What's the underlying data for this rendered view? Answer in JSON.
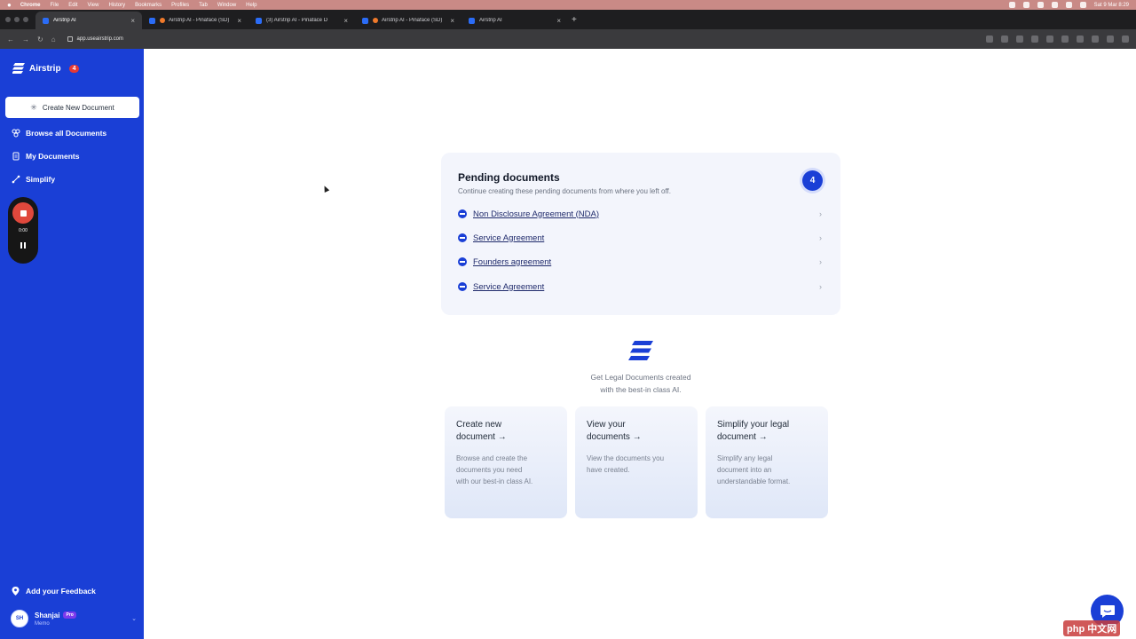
{
  "menubar": {
    "app": "Chrome",
    "items": [
      "File",
      "Edit",
      "View",
      "History",
      "Bookmarks",
      "Profiles",
      "Tab",
      "Window",
      "Help"
    ],
    "clock": "Sat 9 Mar 8:29"
  },
  "tabs": [
    {
      "title": "Airstrip AI",
      "active": true
    },
    {
      "title": "Airstrip AI - Pinaface (SD)",
      "active": false
    },
    {
      "title": "(3) Airstrip AI - Pinaface D",
      "active": false
    },
    {
      "title": "Airstrip AI - Pinaface (SD)",
      "active": false
    },
    {
      "title": "Airstrip AI",
      "active": false
    }
  ],
  "address": {
    "url": "app.useairstrip.com"
  },
  "sidebar": {
    "brand": "Airstrip",
    "brand_badge": "4",
    "create_label": "Create New Document",
    "items": [
      {
        "label": "Browse all Documents"
      },
      {
        "label": "My Documents"
      },
      {
        "label": "Simplify"
      }
    ],
    "recorder_time": "0:00",
    "feedback_label": "Add your Feedback",
    "user": {
      "initials": "SH",
      "name": "Shanjai",
      "badge": "Pro",
      "role": "Memo"
    }
  },
  "pending": {
    "title": "Pending documents",
    "subtitle": "Continue creating these pending documents from where you left off.",
    "count": "4",
    "docs": [
      {
        "name": "Non Disclosure Agreement (NDA)"
      },
      {
        "name": "Service Agreement"
      },
      {
        "name": "Founders agreement"
      },
      {
        "name": "Service Agreement"
      }
    ]
  },
  "tagline": {
    "line1": "Get Legal Documents created",
    "line2": "with the best-in class AI."
  },
  "cards": [
    {
      "title1": "Create new",
      "title2": "document →",
      "desc1": "Browse and create the",
      "desc2": "documents you need",
      "desc3": "with our best-in class AI."
    },
    {
      "title1": "View your",
      "title2": "documents →",
      "desc1": "View the documents you",
      "desc2": "have created.",
      "desc3": ""
    },
    {
      "title1": "Simplify your legal",
      "title2": "document →",
      "desc1": "Simplify any legal",
      "desc2": "document into an",
      "desc3": "understandable format."
    }
  ],
  "watermark": "php 中文网",
  "colors": {
    "brand": "#1a3fd6",
    "menubar": "#c98a86",
    "card_bg": "#f3f5fc"
  }
}
